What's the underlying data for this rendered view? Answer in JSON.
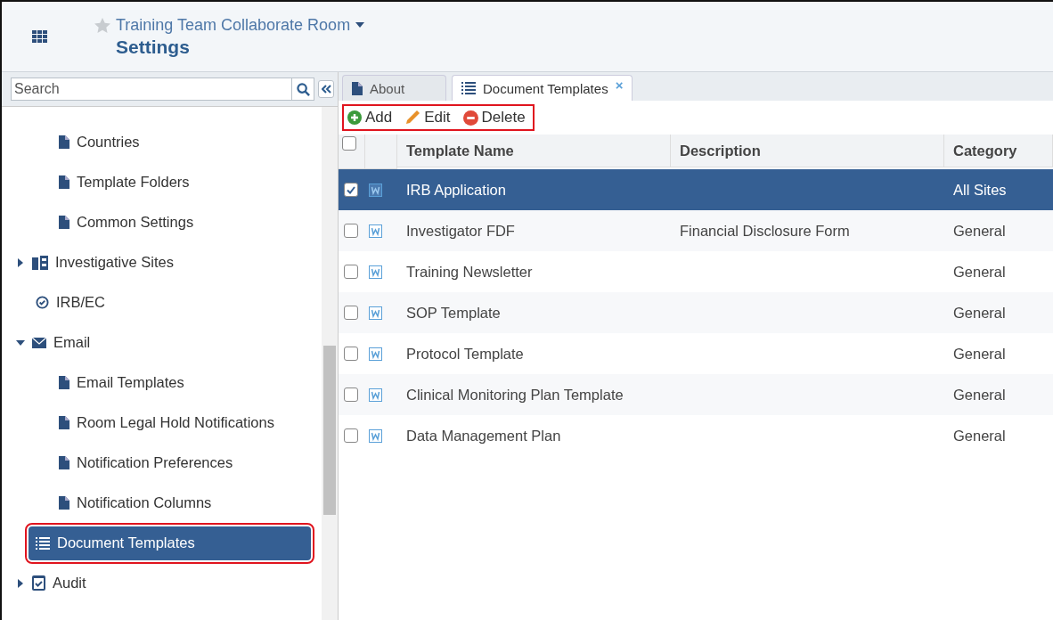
{
  "header": {
    "room": "Training Team Collaborate Room",
    "favorite": false,
    "title": "Settings"
  },
  "sidebar": {
    "search": {
      "placeholder": "Search"
    },
    "orphan_children": [
      {
        "label": "Countries",
        "kind": "page"
      },
      {
        "label": "Template Folders",
        "kind": "page"
      },
      {
        "label": "Common Settings",
        "kind": "page"
      }
    ],
    "items": [
      {
        "label": "Investigative Sites",
        "kind": "sites",
        "expanded": false,
        "selected": false,
        "highlighted": false
      },
      {
        "label": "IRB/EC",
        "kind": "check",
        "selected": false,
        "highlighted": false
      },
      {
        "label": "Email",
        "kind": "email",
        "expanded": true,
        "selected": false,
        "highlighted": false,
        "children": [
          {
            "label": "Email Templates",
            "kind": "page",
            "selected": false,
            "highlighted": false
          },
          {
            "label": "Room Legal Hold Notifications",
            "kind": "page",
            "selected": false,
            "highlighted": false
          },
          {
            "label": "Notification Preferences",
            "kind": "page",
            "selected": false,
            "highlighted": false
          },
          {
            "label": "Notification Columns",
            "kind": "page",
            "selected": false,
            "highlighted": false
          }
        ]
      },
      {
        "label": "Document Templates",
        "kind": "list",
        "selected": true,
        "highlighted": true
      },
      {
        "label": "Audit",
        "kind": "audit",
        "expanded": false,
        "selected": false,
        "highlighted": false
      }
    ]
  },
  "tabs": [
    {
      "label": "About",
      "kind": "page",
      "selected": false,
      "closable": false
    },
    {
      "label": "Document Templates",
      "kind": "list",
      "selected": true,
      "closable": true,
      "close": "×"
    }
  ],
  "toolbar": {
    "highlighted": true,
    "buttons": [
      {
        "label": "Add",
        "kind": "add"
      },
      {
        "label": "Edit",
        "kind": "edit"
      },
      {
        "label": "Delete",
        "kind": "delete"
      }
    ]
  },
  "table": {
    "all_checked": false,
    "columns": [
      "Template Name",
      "Description",
      "Category"
    ],
    "rows": [
      {
        "name": "IRB Application",
        "category": "All Sites",
        "selected": true
      },
      {
        "name": "Investigator FDF",
        "description": "Financial Disclosure Form",
        "category": "General",
        "selected": false
      },
      {
        "name": "Training Newsletter",
        "category": "General",
        "selected": false
      },
      {
        "name": "SOP Template",
        "category": "General",
        "selected": false
      },
      {
        "name": "Protocol Template",
        "category": "General",
        "selected": false
      },
      {
        "name": "Clinical Monitoring Plan Template",
        "category": "General",
        "selected": false
      },
      {
        "name": "Data Management Plan",
        "category": "General",
        "selected": false
      }
    ]
  }
}
